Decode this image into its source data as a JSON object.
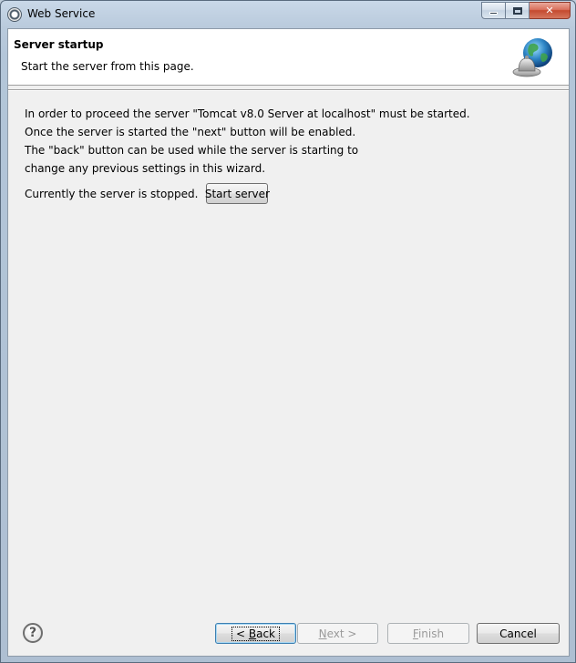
{
  "window": {
    "title": "Web Service",
    "icon": "eclipse-gear-icon"
  },
  "banner": {
    "title": "Server startup",
    "subtitle": "Start the server from this page.",
    "icon": "globe-bell-icon"
  },
  "content": {
    "lines": [
      "In order to proceed the server \"Tomcat v8.0 Server at localhost\" must be started.",
      "Once the server is started the \"next\" button will be enabled.",
      "The \"back\" button can be used while the server is starting to",
      "change any previous settings in this wizard."
    ],
    "status_text": "Currently the server is stopped.",
    "start_button": "Start server"
  },
  "buttons": {
    "back_prefix": "< ",
    "back_mnemonic": "B",
    "back_rest": "ack",
    "next_mnemonic": "N",
    "next_rest": "ext >",
    "finish_mnemonic": "F",
    "finish_rest": "inish",
    "cancel": "Cancel"
  },
  "colors": {
    "title_bar": "#b9cadc",
    "close_button": "#c44a2f",
    "dialog_background": "#f0f0f0"
  }
}
